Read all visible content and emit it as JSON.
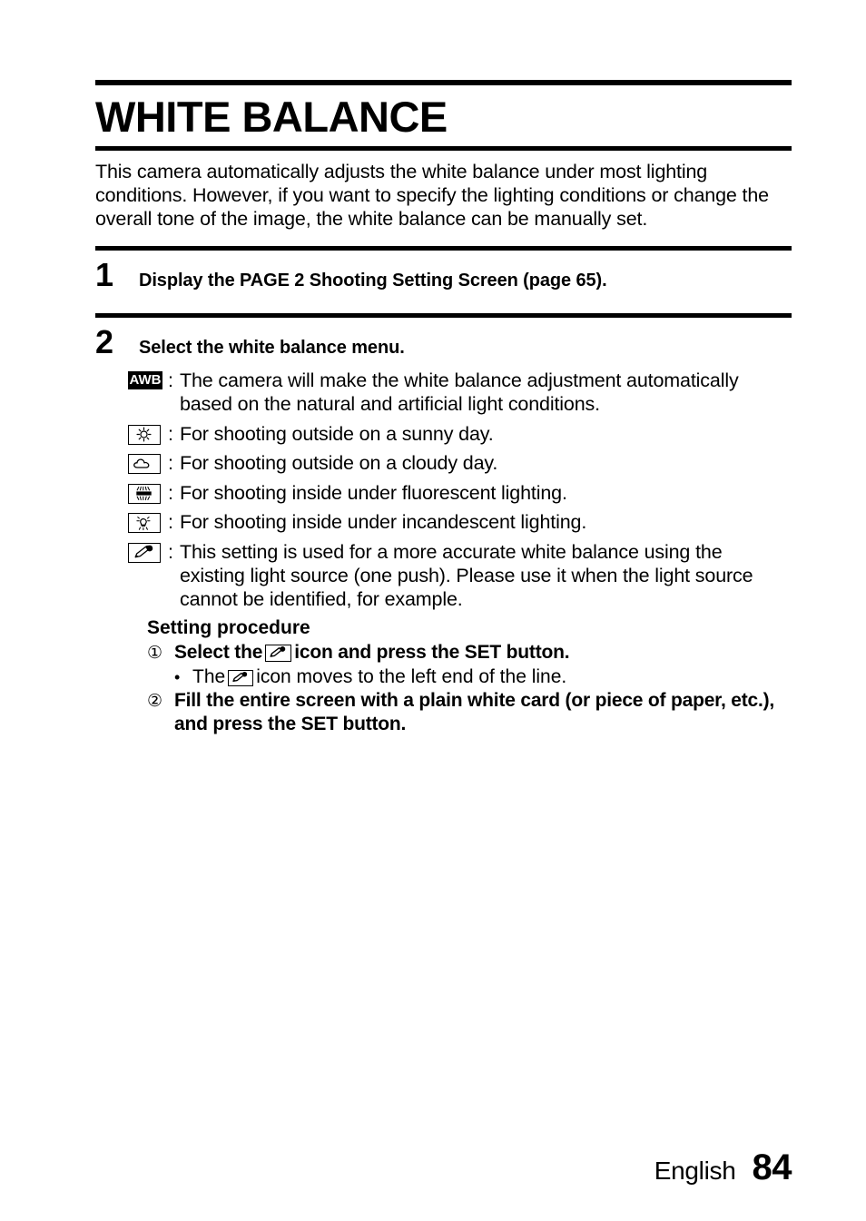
{
  "document": {
    "title": "WHITE BALANCE",
    "intro": "This camera automatically adjusts the white balance under most lighting conditions. However, if you want to specify the lighting conditions or change the overall tone of the image, the white balance can be manually set."
  },
  "steps": [
    {
      "number": "1",
      "text": "Display the PAGE 2 Shooting Setting Screen (page 65)."
    },
    {
      "number": "2",
      "text": "Select the white balance menu."
    }
  ],
  "white_balance_modes": [
    {
      "icon": "awb-icon",
      "icon_label": "AWB",
      "separator": ":",
      "description": "The camera will make the white balance adjustment automatically based on the natural and artificial light conditions."
    },
    {
      "icon": "sun-icon",
      "icon_label": "",
      "separator": ":",
      "description": "For shooting outside on a sunny day."
    },
    {
      "icon": "cloud-icon",
      "icon_label": "",
      "separator": ":",
      "description": "For shooting outside on a cloudy day."
    },
    {
      "icon": "fluorescent-lamp-icon",
      "icon_label": "",
      "separator": ":",
      "description": "For shooting inside under fluorescent lighting."
    },
    {
      "icon": "incandescent-bulb-icon",
      "icon_label": "",
      "separator": ":",
      "description": "For shooting inside under incandescent lighting."
    },
    {
      "icon": "eyedropper-icon",
      "icon_label": "",
      "separator": ":",
      "description": "This setting is used for a more accurate white balance using the existing light source (one push). Please use it when the light source cannot be identified, for example."
    }
  ],
  "procedure": {
    "heading": "Setting procedure",
    "items": [
      {
        "marker": "①",
        "text_before": "Select the",
        "text_after": "icon and press the SET button."
      },
      {
        "marker": "②",
        "text_before": "Fill the entire screen with a plain white card (or piece of paper, etc.), and press the SET button.",
        "text_after": ""
      }
    ],
    "bullet": {
      "marker": "•",
      "text_before": "The",
      "text_after": "icon moves to the left end of the line."
    }
  },
  "footer": {
    "language": "English",
    "page_number": "84"
  }
}
